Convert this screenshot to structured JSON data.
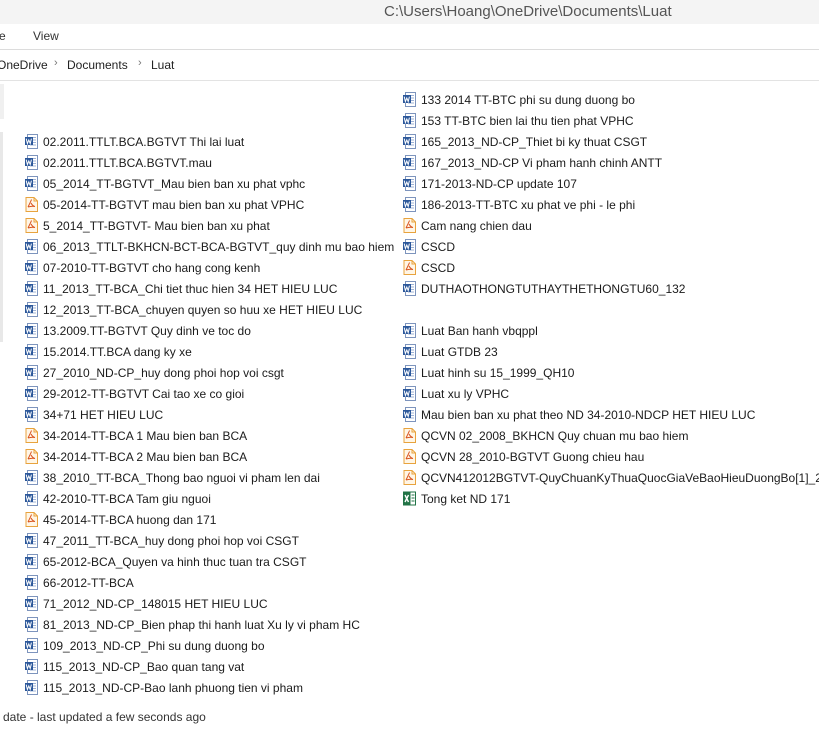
{
  "window": {
    "title": "C:\\Users\\Hoang\\OneDrive\\Documents\\Luat"
  },
  "ribbon": {
    "tabs": [
      "e",
      "View"
    ]
  },
  "address": {
    "crumbs": [
      "OneDrive",
      "Documents",
      "Luat"
    ]
  },
  "colors": {
    "word": "#2b579a",
    "pdf": "#e8a33d",
    "excel": "#217346"
  },
  "files_left": [
    {
      "name": "02.2011.TTLT.BCA.BGTVT Thi lai luat",
      "icon": "word-doc-icon"
    },
    {
      "name": "02.2011.TTLT.BCA.BGTVT.mau",
      "icon": "word-doc-icon"
    },
    {
      "name": "05_2014_TT-BGTVT_Mau bien ban xu phat vphc",
      "icon": "word-doc-icon"
    },
    {
      "name": "05-2014-TT-BGTVT mau bien ban xu phat VPHC",
      "icon": "pdf-doc-icon"
    },
    {
      "name": "5_2014_TT-BGTVT- Mau bien ban xu phat",
      "icon": "pdf-doc-icon"
    },
    {
      "name": "06_2013_TTLT-BKHCN-BCT-BCA-BGTVT_quy dinh mu bao hiem",
      "icon": "word-doc-icon"
    },
    {
      "name": "07-2010-TT-BGTVT cho hang cong kenh",
      "icon": "word-doc-icon"
    },
    {
      "name": "11_2013_TT-BCA_Chi tiet thuc hien 34 HET HIEU LUC",
      "icon": "word-doc-icon"
    },
    {
      "name": "12_2013_TT-BCA_chuyen quyen so huu xe HET HIEU LUC",
      "icon": "word-doc-icon"
    },
    {
      "name": "13.2009.TT-BGTVT Quy dinh ve toc do",
      "icon": "word-doc-icon"
    },
    {
      "name": "15.2014.TT.BCA dang ky xe",
      "icon": "word-doc-icon"
    },
    {
      "name": "27_2010_ND-CP_huy dong phoi hop voi csgt",
      "icon": "word-doc-icon"
    },
    {
      "name": "29-2012-TT-BGTVT Cai tao xe co gioi",
      "icon": "word-doc-icon"
    },
    {
      "name": "34+71 HET HIEU LUC",
      "icon": "word-doc-icon"
    },
    {
      "name": "34-2014-TT-BCA 1 Mau bien ban BCA",
      "icon": "pdf-doc-icon"
    },
    {
      "name": "34-2014-TT-BCA 2 Mau bien ban BCA",
      "icon": "pdf-doc-icon"
    },
    {
      "name": "38_2010_TT-BCA_Thong bao nguoi vi pham len dai",
      "icon": "word-doc-icon"
    },
    {
      "name": "42-2010-TT-BCA Tam giu nguoi",
      "icon": "word-doc-icon"
    },
    {
      "name": "45-2014-TT-BCA huong dan 171",
      "icon": "pdf-doc-icon"
    },
    {
      "name": "47_2011_TT-BCA_huy dong phoi hop voi CSGT",
      "icon": "word-doc-icon"
    },
    {
      "name": "65-2012-BCA_Quyen va hinh thuc tuan tra CSGT",
      "icon": "word-doc-icon"
    },
    {
      "name": "66-2012-TT-BCA",
      "icon": "word-doc-icon"
    },
    {
      "name": "71_2012_ND-CP_148015 HET HIEU LUC",
      "icon": "word-doc-icon"
    },
    {
      "name": "81_2013_ND-CP_Bien phap thi hanh luat Xu ly vi pham HC",
      "icon": "word-doc-icon"
    },
    {
      "name": "109_2013_ND-CP_Phi su dung duong bo",
      "icon": "word-doc-icon"
    },
    {
      "name": "115_2013_ND-CP_Bao quan tang vat",
      "icon": "word-doc-icon"
    },
    {
      "name": "115_2013_ND-CP-Bao lanh phuong tien vi pham",
      "icon": "word-doc-icon"
    }
  ],
  "files_right": [
    {
      "name": "133 2014 TT-BTC phi su dung duong bo",
      "icon": "word-doc-icon"
    },
    {
      "name": "153 TT-BTC bien lai thu tien phat VPHC",
      "icon": "word-doc-icon"
    },
    {
      "name": "165_2013_ND-CP_Thiet bi ky thuat CSGT",
      "icon": "word-doc-icon"
    },
    {
      "name": "167_2013_ND-CP Vi pham hanh chinh ANTT",
      "icon": "word-doc-icon"
    },
    {
      "name": "171-2013-ND-CP update 107",
      "icon": "word-doc-icon"
    },
    {
      "name": "186-2013-TT-BTC xu phat ve phi - le phi",
      "icon": "word-doc-icon"
    },
    {
      "name": "Cam nang chien dau",
      "icon": "pdf-doc-icon"
    },
    {
      "name": "CSCD",
      "icon": "word-doc-icon"
    },
    {
      "name": "CSCD",
      "icon": "pdf-doc-icon"
    },
    {
      "name": "DUTHAOTHONGTUTHAYTHETHONGTU60_132",
      "icon": "word-doc-icon"
    },
    {
      "name": "Luat Ban hanh vbqppl",
      "icon": "word-doc-icon"
    },
    {
      "name": "Luat GTDB 23",
      "icon": "word-doc-icon"
    },
    {
      "name": "Luat hinh su 15_1999_QH10",
      "icon": "word-doc-icon"
    },
    {
      "name": "Luat xu ly VPHC",
      "icon": "word-doc-icon"
    },
    {
      "name": "Mau bien ban xu phat theo ND 34-2010-NDCP HET HIEU LUC",
      "icon": "word-doc-icon"
    },
    {
      "name": "QCVN 02_2008_BKHCN Quy chuan mu bao hiem",
      "icon": "pdf-doc-icon"
    },
    {
      "name": "QCVN 28_2010-BGTVT Guong chieu hau",
      "icon": "pdf-doc-icon"
    },
    {
      "name": "QCVN412012BGTVT-QuyChuanKyThuaQuocGiaVeBaoHieuDuongBo[1]_2",
      "icon": "pdf-doc-icon"
    },
    {
      "name": "Tong ket ND 171",
      "icon": "excel-doc-icon"
    }
  ],
  "status": {
    "text": "date - last updated a few seconds ago"
  }
}
